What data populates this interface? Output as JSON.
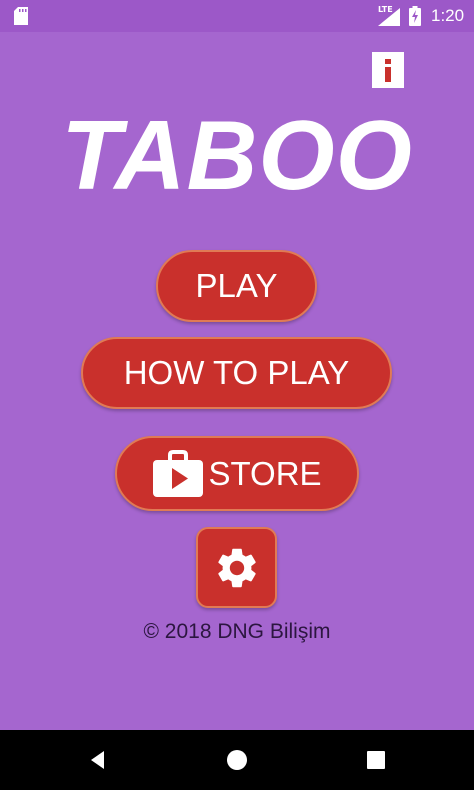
{
  "status_bar": {
    "network": "LTE",
    "time": "1:20",
    "icons": [
      "sd-card-icon",
      "signal-icon",
      "battery-icon"
    ]
  },
  "info_button": {
    "icon": "info-icon"
  },
  "title": "TABOO",
  "menu": {
    "play_label": "PLAY",
    "how_to_play_label": "HOW TO PLAY",
    "store_label": "STORE",
    "store_icon": "store-bag-icon",
    "settings_icon": "gear-icon"
  },
  "footer": {
    "copyright": "© 2018 DNG Bilişim"
  },
  "nav_bar": {
    "icons": [
      "back-icon",
      "home-icon",
      "recents-icon"
    ]
  },
  "colors": {
    "background": "#a566cf",
    "status_bar": "#9c58c8",
    "button": "#c9302c",
    "button_border": "#e07a55",
    "text_light": "#ffffff",
    "text_dark": "#2c1640",
    "info_accent": "#c9302c"
  }
}
